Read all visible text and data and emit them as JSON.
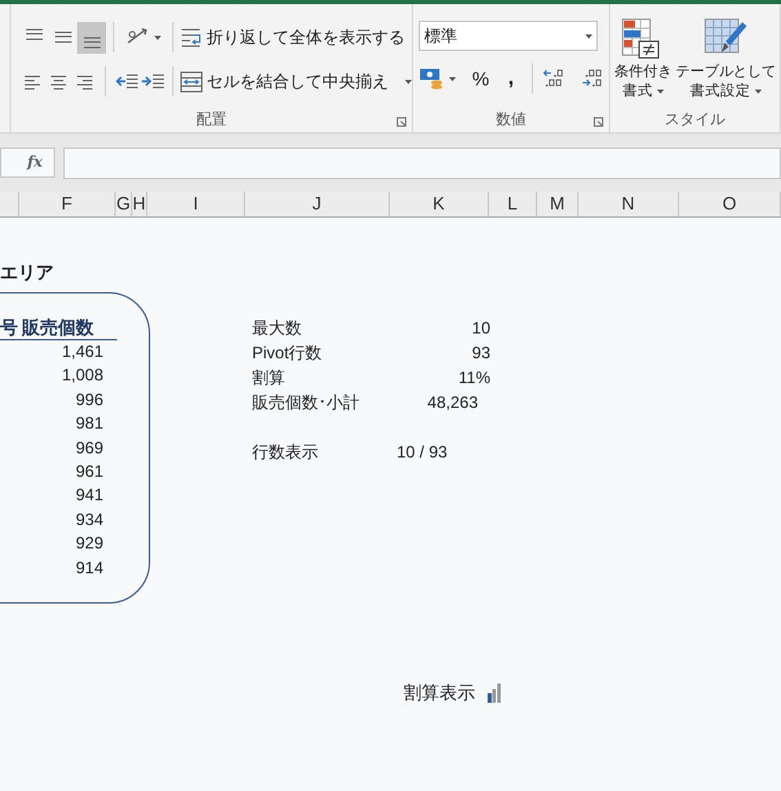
{
  "ribbon": {
    "alignment": {
      "label": "配置",
      "vertical_align": [
        {
          "selected": false
        },
        {
          "selected": false
        },
        {
          "selected": true
        }
      ],
      "wrap_text": "折り返して全体を表示する",
      "merge_center": "セルを結合して中央揃え"
    },
    "number": {
      "label": "数値",
      "format": "標準",
      "percent": "%",
      "comma": ","
    },
    "styles": {
      "label": "スタイル",
      "buttons": [
        {
          "lines": [
            "条件付き",
            "書式"
          ]
        },
        {
          "lines": [
            "テーブルとして",
            "書式設定"
          ]
        }
      ]
    }
  },
  "formula_bar": {
    "function_label": "fx"
  },
  "column_headers": [
    "F",
    "G",
    "H",
    "I",
    "J",
    "K",
    "L",
    "M",
    "N",
    "O"
  ],
  "sheet": {
    "title": "エリア",
    "table": {
      "columns": [
        "号",
        "販売個数"
      ],
      "values": [
        "1,461",
        "1,008",
        "996",
        "981",
        "969",
        "961",
        "941",
        "934",
        "929",
        "914"
      ]
    },
    "stats": [
      {
        "label": "最大数",
        "value": "10"
      },
      {
        "label": "Pivot行数",
        "value": "93"
      },
      {
        "label": "割算",
        "value": "11%"
      },
      {
        "label": "販売個数･小計",
        "value": "48,263"
      }
    ],
    "row_count": {
      "label": "行数表示",
      "value": "10 / 93"
    },
    "toggle_label": "割算表示"
  }
}
